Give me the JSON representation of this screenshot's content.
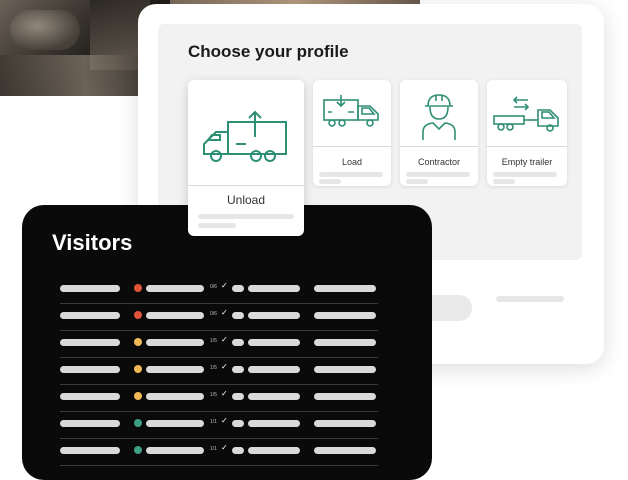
{
  "colors": {
    "icon_green": "#2f8f75",
    "dot_red": "#e0553a",
    "dot_yellow": "#f1b955",
    "dot_green": "#3d9e84"
  },
  "profile": {
    "title": "Choose your profile",
    "options": [
      {
        "label": "Unload",
        "icon": "unload-truck-icon"
      },
      {
        "label": "Load",
        "icon": "load-truck-icon"
      },
      {
        "label": "Contractor",
        "icon": "contractor-icon"
      },
      {
        "label": "Empty trailer",
        "icon": "empty-trailer-icon"
      }
    ]
  },
  "visitors": {
    "title": "Visitors",
    "rows": [
      {
        "status": "red",
        "fraction": "0/6"
      },
      {
        "status": "red",
        "fraction": "0/6"
      },
      {
        "status": "yellow",
        "fraction": "1/5"
      },
      {
        "status": "yellow",
        "fraction": "1/5"
      },
      {
        "status": "yellow",
        "fraction": "1/5"
      },
      {
        "status": "green",
        "fraction": "1/1"
      },
      {
        "status": "green",
        "fraction": "1/1"
      }
    ]
  }
}
